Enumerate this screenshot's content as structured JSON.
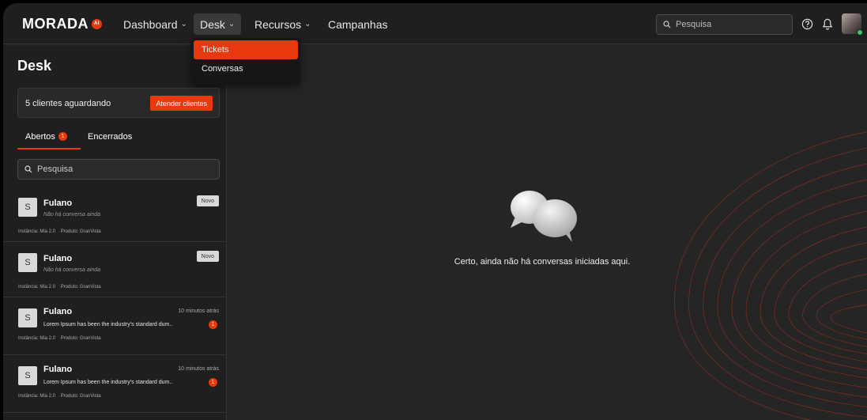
{
  "header": {
    "logo_text": "MORADA",
    "logo_badge": "AI",
    "nav": [
      {
        "label": "Dashboard",
        "has_chevron": true
      },
      {
        "label": "Desk",
        "has_chevron": true
      },
      {
        "label": "Recursos",
        "has_chevron": true
      },
      {
        "label": "Campanhas",
        "has_chevron": false
      }
    ],
    "search_placeholder": "Pesquisa"
  },
  "desk_menu": {
    "items": [
      "Tickets",
      "Conversas"
    ],
    "selected": "Tickets"
  },
  "sidebar": {
    "title": "Desk",
    "waiting_text": "5 clientes aguardando",
    "waiting_button": "Atender clientes",
    "tabs": [
      {
        "label": "Abertos",
        "badge": "1"
      },
      {
        "label": "Encerrados"
      }
    ],
    "search_placeholder": "Pesquisa",
    "conversations": [
      {
        "avatar": "S",
        "name": "Fulano",
        "subtitle": "Não há conversa ainda",
        "tag": "Novo",
        "instance": "Instância: Mia 2.0",
        "product": "Produto: GranVista"
      },
      {
        "avatar": "S",
        "name": "Fulano",
        "subtitle": "Não há conversa ainda",
        "tag": "Novo",
        "instance": "Instância: Mia 2.0",
        "product": "Produto: GranVista"
      },
      {
        "avatar": "S",
        "name": "Fulano",
        "time": "10 minutos atrás",
        "message": "Lorem Ipsum has been the industry's standard dum..",
        "badge": "1",
        "instance": "Instância: Mia 2.0",
        "product": "Produto: GranVista"
      },
      {
        "avatar": "S",
        "name": "Fulano",
        "time": "10 minutos atrás",
        "message": "Lorem Ipsum has been the industry's standard dum..",
        "badge": "1",
        "instance": "Instância: Mia 2.0",
        "product": "Produto: GranVista"
      }
    ]
  },
  "main": {
    "empty_icon": "chat-bubbles-icon",
    "empty_text": "Certo, ainda não há conversas iniciadas aqui."
  },
  "colors": {
    "accent": "#e8390e",
    "background": "#252525",
    "panel": "#1f1f1f"
  }
}
